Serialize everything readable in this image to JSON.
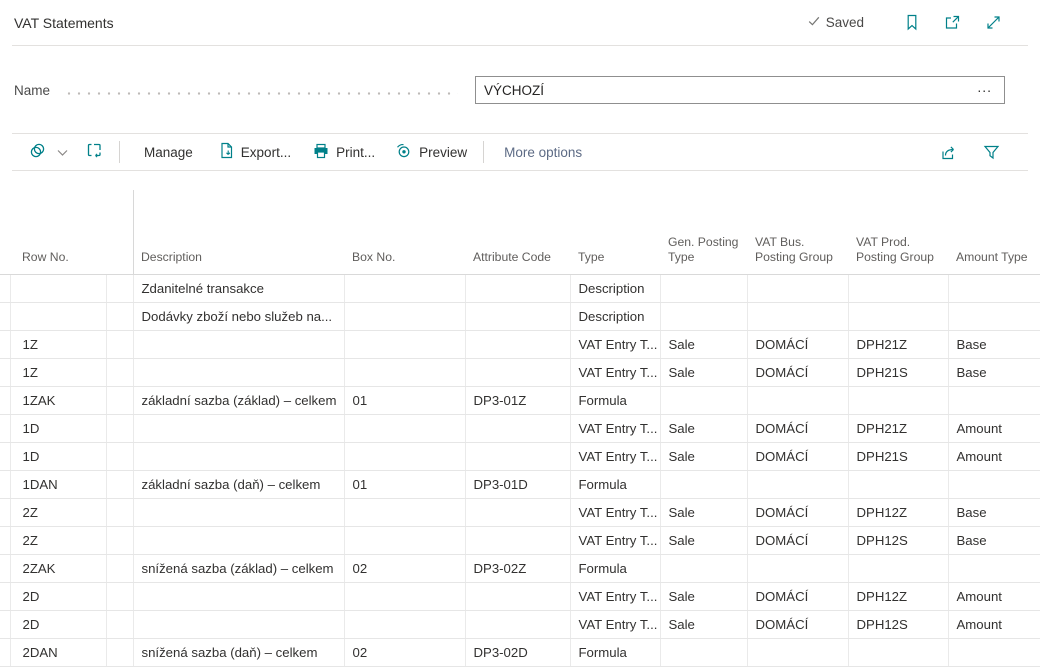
{
  "header": {
    "title": "VAT Statements",
    "saved_label": "Saved",
    "icons": [
      "check-icon",
      "bookmark-icon",
      "open-in-new-window-icon",
      "expand-view-icon"
    ]
  },
  "name_field": {
    "label": "Name",
    "value": "VÝCHOZÍ",
    "assist_edit_label": "..."
  },
  "toolbar": {
    "views_icon": "views-icon",
    "layout_icon": "switch-layout-icon",
    "manage_label": "Manage",
    "export_label": "Export...",
    "print_label": "Print...",
    "preview_label": "Preview",
    "more_options_label": "More options",
    "right_icons": [
      "share-icon",
      "filter-icon"
    ]
  },
  "table": {
    "columns": [
      "Row No.",
      "Description",
      "Box No.",
      "Attribute Code",
      "Type",
      "Gen. Posting Type",
      "VAT Bus. Posting Group",
      "VAT Prod. Posting Group",
      "Amount Type"
    ],
    "rows": [
      {
        "row_no": "",
        "description": "Zdanitelné transakce",
        "box_no": "",
        "attribute_code": "",
        "type": "Description",
        "gen_posting_type": "",
        "vat_bus_posting_group": "",
        "vat_prod_posting_group": "",
        "amount_type": ""
      },
      {
        "row_no": "",
        "description": "Dodávky zboží nebo služeb na...",
        "box_no": "",
        "attribute_code": "",
        "type": "Description",
        "gen_posting_type": "",
        "vat_bus_posting_group": "",
        "vat_prod_posting_group": "",
        "amount_type": ""
      },
      {
        "row_no": "1Z",
        "description": "",
        "box_no": "",
        "attribute_code": "",
        "type": "VAT Entry T...",
        "gen_posting_type": "Sale",
        "vat_bus_posting_group": "DOMÁCÍ",
        "vat_prod_posting_group": "DPH21Z",
        "amount_type": "Base"
      },
      {
        "row_no": "1Z",
        "description": "",
        "box_no": "",
        "attribute_code": "",
        "type": "VAT Entry T...",
        "gen_posting_type": "Sale",
        "vat_bus_posting_group": "DOMÁCÍ",
        "vat_prod_posting_group": "DPH21S",
        "amount_type": "Base"
      },
      {
        "row_no": "1ZAK",
        "description": "základní sazba (základ) – celkem",
        "box_no": "01",
        "attribute_code": "DP3-01Z",
        "type": "Formula",
        "gen_posting_type": "",
        "vat_bus_posting_group": "",
        "vat_prod_posting_group": "",
        "amount_type": ""
      },
      {
        "row_no": "1D",
        "description": "",
        "box_no": "",
        "attribute_code": "",
        "type": "VAT Entry T...",
        "gen_posting_type": "Sale",
        "vat_bus_posting_group": "DOMÁCÍ",
        "vat_prod_posting_group": "DPH21Z",
        "amount_type": "Amount"
      },
      {
        "row_no": "1D",
        "description": "",
        "box_no": "",
        "attribute_code": "",
        "type": "VAT Entry T...",
        "gen_posting_type": "Sale",
        "vat_bus_posting_group": "DOMÁCÍ",
        "vat_prod_posting_group": "DPH21S",
        "amount_type": "Amount"
      },
      {
        "row_no": "1DAN",
        "description": "základní sazba (daň) – celkem",
        "box_no": "01",
        "attribute_code": "DP3-01D",
        "type": "Formula",
        "gen_posting_type": "",
        "vat_bus_posting_group": "",
        "vat_prod_posting_group": "",
        "amount_type": ""
      },
      {
        "row_no": "2Z",
        "description": "",
        "box_no": "",
        "attribute_code": "",
        "type": "VAT Entry T...",
        "gen_posting_type": "Sale",
        "vat_bus_posting_group": "DOMÁCÍ",
        "vat_prod_posting_group": "DPH12Z",
        "amount_type": "Base"
      },
      {
        "row_no": "2Z",
        "description": "",
        "box_no": "",
        "attribute_code": "",
        "type": "VAT Entry T...",
        "gen_posting_type": "Sale",
        "vat_bus_posting_group": "DOMÁCÍ",
        "vat_prod_posting_group": "DPH12S",
        "amount_type": "Base"
      },
      {
        "row_no": "2ZAK",
        "description": "snížená sazba (základ) – celkem",
        "box_no": "02",
        "attribute_code": "DP3-02Z",
        "type": "Formula",
        "gen_posting_type": "",
        "vat_bus_posting_group": "",
        "vat_prod_posting_group": "",
        "amount_type": ""
      },
      {
        "row_no": "2D",
        "description": "",
        "box_no": "",
        "attribute_code": "",
        "type": "VAT Entry T...",
        "gen_posting_type": "Sale",
        "vat_bus_posting_group": "DOMÁCÍ",
        "vat_prod_posting_group": "DPH12Z",
        "amount_type": "Amount"
      },
      {
        "row_no": "2D",
        "description": "",
        "box_no": "",
        "attribute_code": "",
        "type": "VAT Entry T...",
        "gen_posting_type": "Sale",
        "vat_bus_posting_group": "DOMÁCÍ",
        "vat_prod_posting_group": "DPH12S",
        "amount_type": "Amount"
      },
      {
        "row_no": "2DAN",
        "description": "snížená sazba (daň) – celkem",
        "box_no": "02",
        "attribute_code": "DP3-02D",
        "type": "Formula",
        "gen_posting_type": "",
        "vat_bus_posting_group": "",
        "vat_prod_posting_group": "",
        "amount_type": ""
      }
    ]
  },
  "colors": {
    "accent": "#008089",
    "text": "#323130",
    "muted_text": "#605e5c",
    "grid_line": "#e6e6e6",
    "input_border": "#8f8f8f"
  }
}
